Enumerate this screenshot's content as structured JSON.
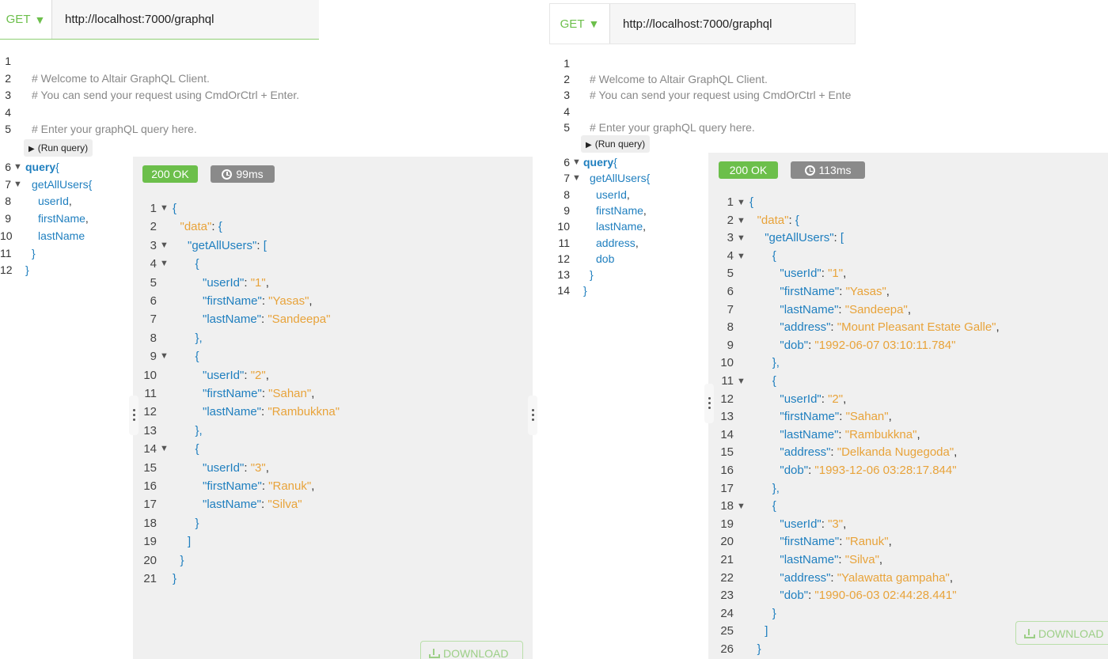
{
  "left": {
    "method": "GET",
    "method_caret": "▼",
    "url": "http://localhost:7000/graphql",
    "query_lines": [
      {
        "n": "1",
        "text": "",
        "cls": "comment",
        "fold": false
      },
      {
        "n": "2",
        "text": "# Welcome to Altair GraphQL Client.",
        "cls": "comment",
        "fold": false
      },
      {
        "n": "3",
        "text": "# You can send your request using CmdOrCtrl + Enter.",
        "cls": "comment",
        "fold": false
      },
      {
        "n": "4",
        "text": "",
        "cls": "comment",
        "fold": false
      },
      {
        "n": "5",
        "text": "# Enter your graphQL query here.",
        "cls": "comment",
        "fold": false
      },
      {
        "n": "6",
        "kw": "query",
        "text": "{",
        "cls": "punc",
        "fold": true
      },
      {
        "n": "7",
        "text": "getAllUsers{",
        "cls": "field",
        "fold": true,
        "indent": 1
      },
      {
        "n": "8",
        "text": "userId",
        "suffix": ",",
        "cls": "field",
        "fold": false,
        "indent": 2
      },
      {
        "n": "9",
        "text": "firstName",
        "suffix": ",",
        "cls": "field",
        "fold": false,
        "indent": 2
      },
      {
        "n": "10",
        "text": "lastName",
        "cls": "field",
        "fold": false,
        "indent": 2
      },
      {
        "n": "11",
        "text": "}",
        "cls": "field",
        "fold": false,
        "indent": 1
      },
      {
        "n": "12",
        "text": "}",
        "cls": "field",
        "fold": false,
        "indent": 0
      }
    ],
    "run_label": "(Run query)",
    "status": "200 OK",
    "time": "99ms",
    "download": "DOWNLOAD",
    "result_lines": [
      {
        "n": "1",
        "fold": true,
        "indent": 0,
        "parts": [
          [
            "br",
            "{"
          ]
        ]
      },
      {
        "n": "2",
        "fold": false,
        "indent": 1,
        "parts": [
          [
            "rootkey",
            "\"data\""
          ],
          [
            "punc",
            ": "
          ],
          [
            "br",
            "{"
          ]
        ]
      },
      {
        "n": "3",
        "fold": true,
        "indent": 2,
        "parts": [
          [
            "key",
            "\"getAllUsers\""
          ],
          [
            "punc",
            ": "
          ],
          [
            "br",
            "["
          ]
        ]
      },
      {
        "n": "4",
        "fold": true,
        "indent": 3,
        "parts": [
          [
            "br",
            "{"
          ]
        ]
      },
      {
        "n": "5",
        "fold": false,
        "indent": 4,
        "parts": [
          [
            "key",
            "\"userId\""
          ],
          [
            "punc",
            ": "
          ],
          [
            "str",
            "\"1\""
          ],
          [
            "punc",
            ","
          ]
        ]
      },
      {
        "n": "6",
        "fold": false,
        "indent": 4,
        "parts": [
          [
            "key",
            "\"firstName\""
          ],
          [
            "punc",
            ": "
          ],
          [
            "str",
            "\"Yasas\""
          ],
          [
            "punc",
            ","
          ]
        ]
      },
      {
        "n": "7",
        "fold": false,
        "indent": 4,
        "parts": [
          [
            "key",
            "\"lastName\""
          ],
          [
            "punc",
            ": "
          ],
          [
            "str",
            "\"Sandeepa\""
          ]
        ]
      },
      {
        "n": "8",
        "fold": false,
        "indent": 3,
        "parts": [
          [
            "br",
            "},"
          ]
        ]
      },
      {
        "n": "9",
        "fold": true,
        "indent": 3,
        "parts": [
          [
            "br",
            "{"
          ]
        ]
      },
      {
        "n": "10",
        "fold": false,
        "indent": 4,
        "parts": [
          [
            "key",
            "\"userId\""
          ],
          [
            "punc",
            ": "
          ],
          [
            "str",
            "\"2\""
          ],
          [
            "punc",
            ","
          ]
        ]
      },
      {
        "n": "11",
        "fold": false,
        "indent": 4,
        "parts": [
          [
            "key",
            "\"firstName\""
          ],
          [
            "punc",
            ": "
          ],
          [
            "str",
            "\"Sahan\""
          ],
          [
            "punc",
            ","
          ]
        ]
      },
      {
        "n": "12",
        "fold": false,
        "indent": 4,
        "parts": [
          [
            "key",
            "\"lastName\""
          ],
          [
            "punc",
            ": "
          ],
          [
            "str",
            "\"Rambukkna\""
          ]
        ]
      },
      {
        "n": "13",
        "fold": false,
        "indent": 3,
        "parts": [
          [
            "br",
            "},"
          ]
        ]
      },
      {
        "n": "14",
        "fold": true,
        "indent": 3,
        "parts": [
          [
            "br",
            "{"
          ]
        ]
      },
      {
        "n": "15",
        "fold": false,
        "indent": 4,
        "parts": [
          [
            "key",
            "\"userId\""
          ],
          [
            "punc",
            ": "
          ],
          [
            "str",
            "\"3\""
          ],
          [
            "punc",
            ","
          ]
        ]
      },
      {
        "n": "16",
        "fold": false,
        "indent": 4,
        "parts": [
          [
            "key",
            "\"firstName\""
          ],
          [
            "punc",
            ": "
          ],
          [
            "str",
            "\"Ranuk\""
          ],
          [
            "punc",
            ","
          ]
        ]
      },
      {
        "n": "17",
        "fold": false,
        "indent": 4,
        "parts": [
          [
            "key",
            "\"lastName\""
          ],
          [
            "punc",
            ": "
          ],
          [
            "str",
            "\"Silva\""
          ]
        ]
      },
      {
        "n": "18",
        "fold": false,
        "indent": 3,
        "parts": [
          [
            "br",
            "}"
          ]
        ]
      },
      {
        "n": "19",
        "fold": false,
        "indent": 2,
        "parts": [
          [
            "br",
            "]"
          ]
        ]
      },
      {
        "n": "20",
        "fold": false,
        "indent": 1,
        "parts": [
          [
            "br",
            "}"
          ]
        ]
      },
      {
        "n": "21",
        "fold": false,
        "indent": 0,
        "parts": [
          [
            "br",
            "}"
          ]
        ]
      }
    ]
  },
  "right": {
    "method": "GET",
    "method_caret": "▼",
    "url": "http://localhost:7000/graphql",
    "query_lines": [
      {
        "n": "1",
        "text": "",
        "cls": "comment",
        "fold": false
      },
      {
        "n": "2",
        "text": "# Welcome to Altair GraphQL Client.",
        "cls": "comment",
        "fold": false
      },
      {
        "n": "3",
        "text": "# You can send your request using CmdOrCtrl + Ente",
        "cls": "comment",
        "fold": false
      },
      {
        "n": "4",
        "text": "",
        "cls": "comment",
        "fold": false
      },
      {
        "n": "5",
        "text": "# Enter your graphQL query here.",
        "cls": "comment",
        "fold": false
      },
      {
        "n": "6",
        "kw": "query",
        "text": "{",
        "cls": "punc",
        "fold": true
      },
      {
        "n": "7",
        "text": "getAllUsers{",
        "cls": "field",
        "fold": true,
        "indent": 1
      },
      {
        "n": "8",
        "text": "userId",
        "suffix": ",",
        "cls": "field",
        "fold": false,
        "indent": 2
      },
      {
        "n": "9",
        "text": "firstName",
        "suffix": ",",
        "cls": "field",
        "fold": false,
        "indent": 2
      },
      {
        "n": "10",
        "text": "lastName",
        "suffix": ",",
        "cls": "field",
        "fold": false,
        "indent": 2
      },
      {
        "n": "11",
        "text": "address",
        "suffix": ",",
        "cls": "field",
        "fold": false,
        "indent": 2
      },
      {
        "n": "12",
        "text": "dob",
        "cls": "field",
        "fold": false,
        "indent": 2
      },
      {
        "n": "13",
        "text": "}",
        "cls": "field",
        "fold": false,
        "indent": 1
      },
      {
        "n": "14",
        "text": "}",
        "cls": "field",
        "fold": false,
        "indent": 0
      }
    ],
    "run_label": "(Run query)",
    "status": "200 OK",
    "time": "113ms",
    "download": "DOWNLOAD",
    "result_lines": [
      {
        "n": "1",
        "fold": true,
        "indent": 0,
        "parts": [
          [
            "br",
            "{"
          ]
        ]
      },
      {
        "n": "2",
        "fold": true,
        "indent": 1,
        "parts": [
          [
            "rootkey",
            "\"data\""
          ],
          [
            "punc",
            ": "
          ],
          [
            "br",
            "{"
          ]
        ]
      },
      {
        "n": "3",
        "fold": true,
        "indent": 2,
        "parts": [
          [
            "key",
            "\"getAllUsers\""
          ],
          [
            "punc",
            ": "
          ],
          [
            "br",
            "["
          ]
        ]
      },
      {
        "n": "4",
        "fold": true,
        "indent": 3,
        "parts": [
          [
            "br",
            "{"
          ]
        ]
      },
      {
        "n": "5",
        "fold": false,
        "indent": 4,
        "parts": [
          [
            "key",
            "\"userId\""
          ],
          [
            "punc",
            ": "
          ],
          [
            "str",
            "\"1\""
          ],
          [
            "punc",
            ","
          ]
        ]
      },
      {
        "n": "6",
        "fold": false,
        "indent": 4,
        "parts": [
          [
            "key",
            "\"firstName\""
          ],
          [
            "punc",
            ": "
          ],
          [
            "str",
            "\"Yasas\""
          ],
          [
            "punc",
            ","
          ]
        ]
      },
      {
        "n": "7",
        "fold": false,
        "indent": 4,
        "parts": [
          [
            "key",
            "\"lastName\""
          ],
          [
            "punc",
            ": "
          ],
          [
            "str",
            "\"Sandeepa\""
          ],
          [
            "punc",
            ","
          ]
        ]
      },
      {
        "n": "8",
        "fold": false,
        "indent": 4,
        "parts": [
          [
            "key",
            "\"address\""
          ],
          [
            "punc",
            ": "
          ],
          [
            "str",
            "\"Mount Pleasant Estate Galle\""
          ],
          [
            "punc",
            ","
          ]
        ]
      },
      {
        "n": "9",
        "fold": false,
        "indent": 4,
        "parts": [
          [
            "key",
            "\"dob\""
          ],
          [
            "punc",
            ": "
          ],
          [
            "str",
            "\"1992-06-07 03:10:11.784\""
          ]
        ]
      },
      {
        "n": "10",
        "fold": false,
        "indent": 3,
        "parts": [
          [
            "br",
            "},"
          ]
        ]
      },
      {
        "n": "11",
        "fold": true,
        "indent": 3,
        "parts": [
          [
            "br",
            "{"
          ]
        ]
      },
      {
        "n": "12",
        "fold": false,
        "indent": 4,
        "parts": [
          [
            "key",
            "\"userId\""
          ],
          [
            "punc",
            ": "
          ],
          [
            "str",
            "\"2\""
          ],
          [
            "punc",
            ","
          ]
        ]
      },
      {
        "n": "13",
        "fold": false,
        "indent": 4,
        "parts": [
          [
            "key",
            "\"firstName\""
          ],
          [
            "punc",
            ": "
          ],
          [
            "str",
            "\"Sahan\""
          ],
          [
            "punc",
            ","
          ]
        ]
      },
      {
        "n": "14",
        "fold": false,
        "indent": 4,
        "parts": [
          [
            "key",
            "\"lastName\""
          ],
          [
            "punc",
            ": "
          ],
          [
            "str",
            "\"Rambukkna\""
          ],
          [
            "punc",
            ","
          ]
        ]
      },
      {
        "n": "15",
        "fold": false,
        "indent": 4,
        "parts": [
          [
            "key",
            "\"address\""
          ],
          [
            "punc",
            ": "
          ],
          [
            "str",
            "\"Delkanda Nugegoda\""
          ],
          [
            "punc",
            ","
          ]
        ]
      },
      {
        "n": "16",
        "fold": false,
        "indent": 4,
        "parts": [
          [
            "key",
            "\"dob\""
          ],
          [
            "punc",
            ": "
          ],
          [
            "str",
            "\"1993-12-06 03:28:17.844\""
          ]
        ]
      },
      {
        "n": "17",
        "fold": false,
        "indent": 3,
        "parts": [
          [
            "br",
            "},"
          ]
        ]
      },
      {
        "n": "18",
        "fold": true,
        "indent": 3,
        "parts": [
          [
            "br",
            "{"
          ]
        ]
      },
      {
        "n": "19",
        "fold": false,
        "indent": 4,
        "parts": [
          [
            "key",
            "\"userId\""
          ],
          [
            "punc",
            ": "
          ],
          [
            "str",
            "\"3\""
          ],
          [
            "punc",
            ","
          ]
        ]
      },
      {
        "n": "20",
        "fold": false,
        "indent": 4,
        "parts": [
          [
            "key",
            "\"firstName\""
          ],
          [
            "punc",
            ": "
          ],
          [
            "str",
            "\"Ranuk\""
          ],
          [
            "punc",
            ","
          ]
        ]
      },
      {
        "n": "21",
        "fold": false,
        "indent": 4,
        "parts": [
          [
            "key",
            "\"lastName\""
          ],
          [
            "punc",
            ": "
          ],
          [
            "str",
            "\"Silva\""
          ],
          [
            "punc",
            ","
          ]
        ]
      },
      {
        "n": "22",
        "fold": false,
        "indent": 4,
        "parts": [
          [
            "key",
            "\"address\""
          ],
          [
            "punc",
            ": "
          ],
          [
            "str",
            "\"Yalawatta gampaha\""
          ],
          [
            "punc",
            ","
          ]
        ]
      },
      {
        "n": "23",
        "fold": false,
        "indent": 4,
        "parts": [
          [
            "key",
            "\"dob\""
          ],
          [
            "punc",
            ": "
          ],
          [
            "str",
            "\"1990-06-03 02:44:28.441\""
          ]
        ]
      },
      {
        "n": "24",
        "fold": false,
        "indent": 3,
        "parts": [
          [
            "br",
            "}"
          ]
        ]
      },
      {
        "n": "25",
        "fold": false,
        "indent": 2,
        "parts": [
          [
            "br",
            "]"
          ]
        ]
      },
      {
        "n": "26",
        "fold": false,
        "indent": 1,
        "parts": [
          [
            "br",
            "}"
          ]
        ]
      }
    ]
  }
}
